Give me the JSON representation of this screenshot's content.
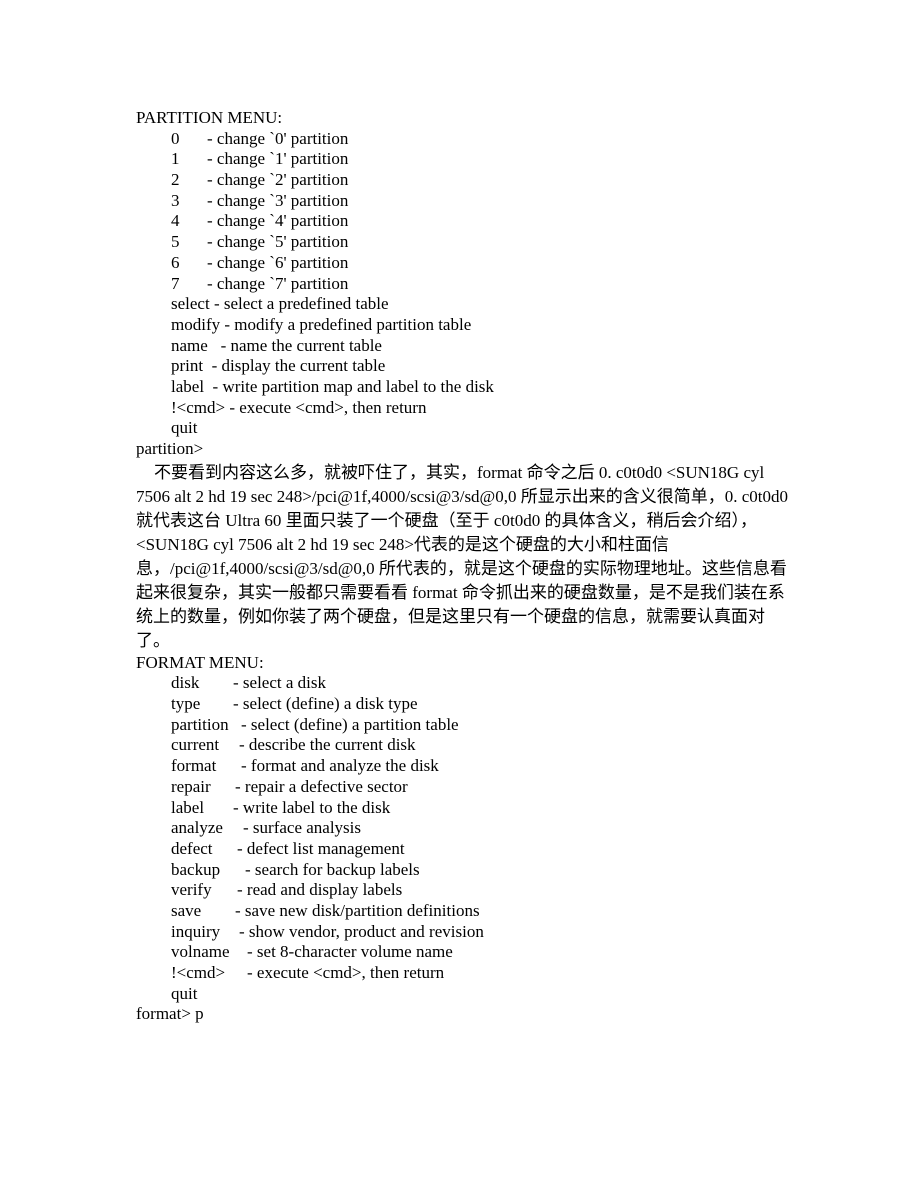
{
  "partition_menu": {
    "title": "PARTITION MENU:",
    "numbered_items": [
      {
        "key": "0",
        "desc": "- change `0' partition"
      },
      {
        "key": "1",
        "desc": "- change `1' partition"
      },
      {
        "key": "2",
        "desc": "- change `2' partition"
      },
      {
        "key": "3",
        "desc": "- change `3' partition"
      },
      {
        "key": "4",
        "desc": "- change `4' partition"
      },
      {
        "key": "5",
        "desc": "- change `5' partition"
      },
      {
        "key": "6",
        "desc": "- change `6' partition"
      },
      {
        "key": "7",
        "desc": "- change `7' partition"
      }
    ],
    "command_items": [
      "select - select a predefined table",
      "modify - modify a predefined partition table",
      "name   - name the current table",
      "print  - display the current table",
      "label  - write partition map and label to the disk",
      "!<cmd> - execute <cmd>, then return",
      "quit"
    ],
    "prompt": "partition>"
  },
  "explanation": "不要看到内容这么多，就被吓住了，其实，format 命令之后 0. c0t0d0 <SUN18G cyl 7506 alt 2 hd 19 sec 248>/pci@1f,4000/scsi@3/sd@0,0 所显示出来的含义很简单，0. c0t0d0 就代表这台 Ultra 60 里面只装了一个硬盘（至于 c0t0d0 的具体含义，稍后会介绍），<SUN18G cyl 7506 alt 2 hd 19 sec 248>代表的是这个硬盘的大小和柱面信息，/pci@1f,4000/scsi@3/sd@0,0 所代表的，就是这个硬盘的实际物理地址。这些信息看起来很复杂，其实一般都只需要看看 format 命令抓出来的硬盘数量，是不是我们装在系统上的数量，例如你装了两个硬盘，但是这里只有一个硬盘的信息，就需要认真面对了。",
  "format_menu": {
    "title": "FORMAT MENU:",
    "items": [
      {
        "key": "disk",
        "desc": "- select a disk"
      },
      {
        "key": "type",
        "desc": "- select (define) a disk type"
      },
      {
        "key": "partition",
        "desc": "- select (define) a partition table"
      },
      {
        "key": "current",
        "desc": "- describe the current disk"
      },
      {
        "key": "format",
        "desc": "- format and analyze the disk"
      },
      {
        "key": "repair",
        "desc": "- repair a defective sector"
      },
      {
        "key": "label",
        "desc": "- write label to the disk"
      },
      {
        "key": "analyze",
        "desc": "- surface analysis"
      },
      {
        "key": "defect",
        "desc": "- defect list management"
      },
      {
        "key": "backup",
        "desc": "- search for backup labels"
      },
      {
        "key": "verify",
        "desc": "- read and display labels"
      },
      {
        "key": "save",
        "desc": "- save new disk/partition definitions"
      },
      {
        "key": "inquiry",
        "desc": "- show vendor, product and revision"
      },
      {
        "key": "volname",
        "desc": "- set 8-character volume name"
      },
      {
        "key": "!<cmd>",
        "desc": "- execute <cmd>, then return"
      },
      {
        "key": "quit",
        "desc": ""
      }
    ],
    "prompt": "format> p"
  }
}
